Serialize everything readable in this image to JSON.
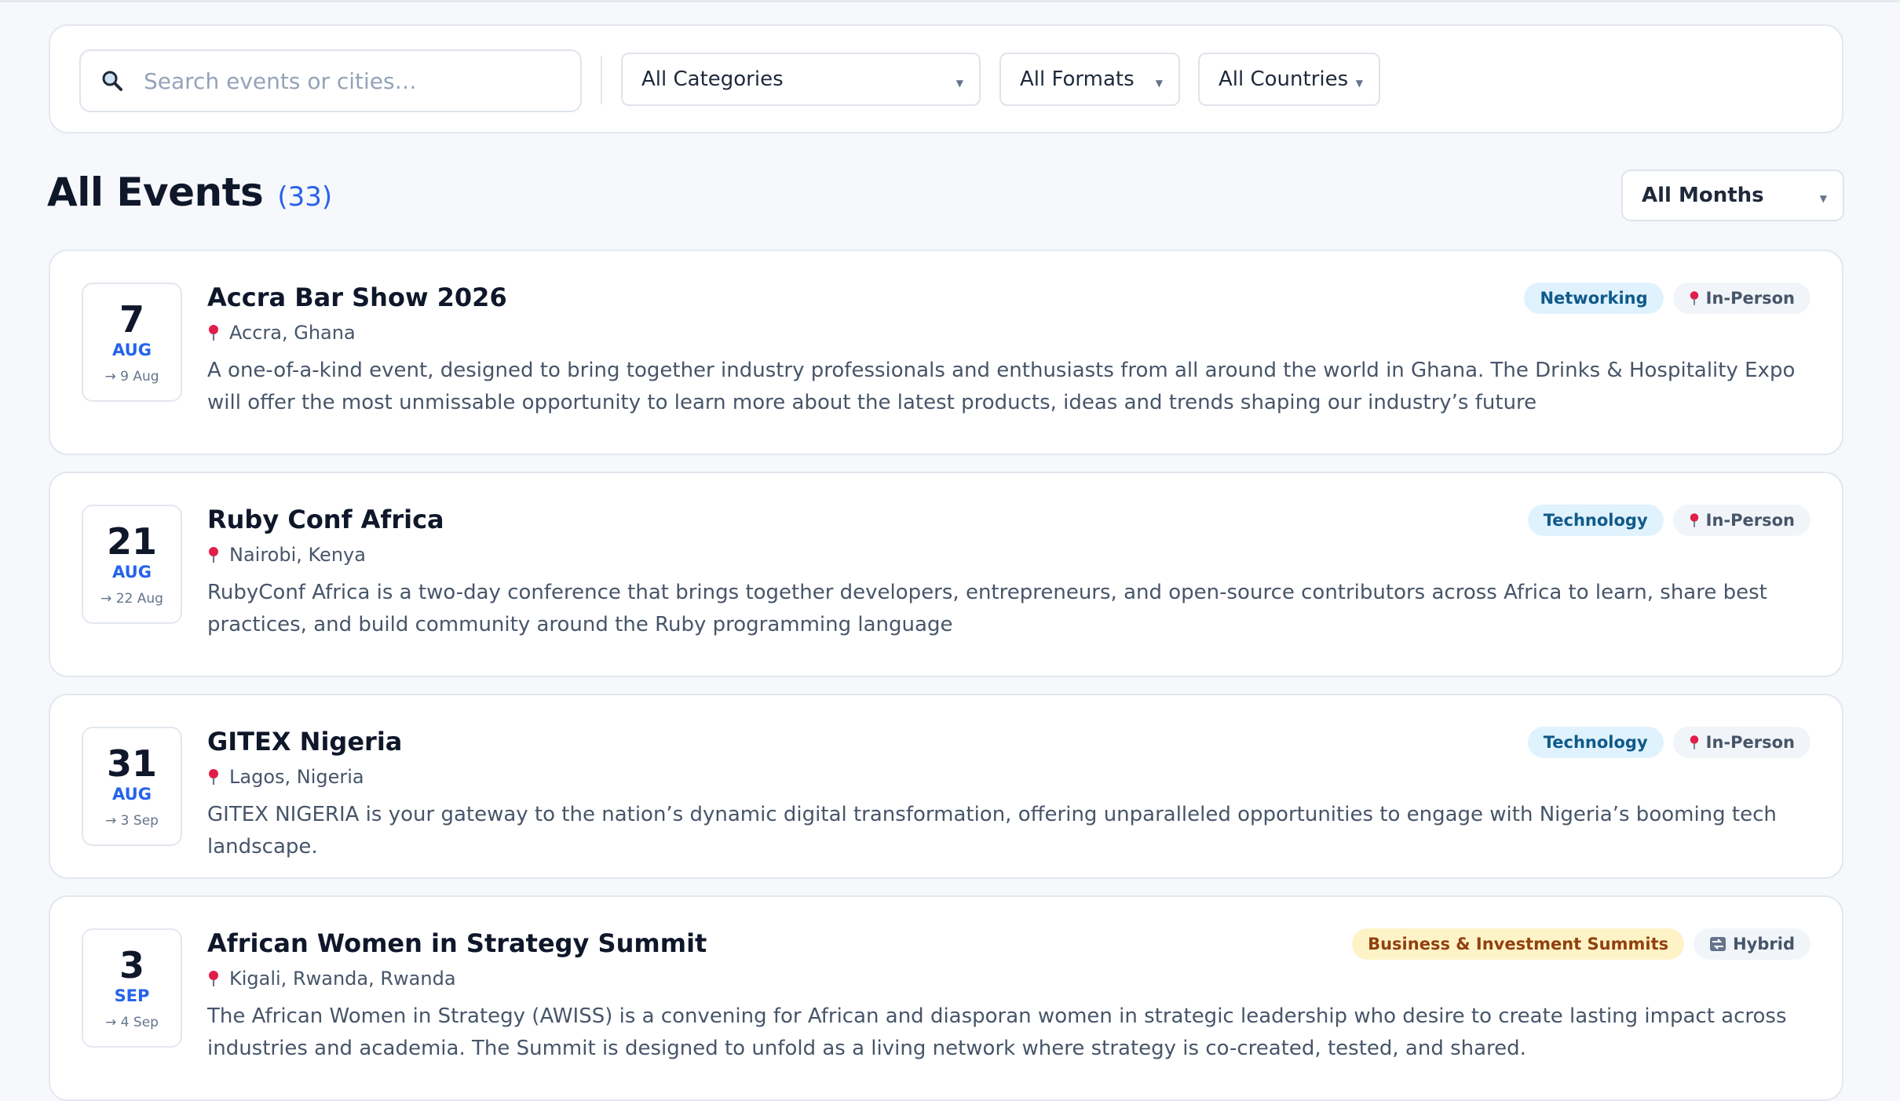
{
  "search": {
    "placeholder": "Search events or cities…",
    "icon": "search-icon"
  },
  "filters": {
    "category": "All Categories",
    "format": "All Formats",
    "country": "All Countries"
  },
  "heading": {
    "title": "All Events",
    "count": "(33)"
  },
  "month_filter": "All Months",
  "colors": {
    "accent": "#2563eb",
    "category_blue_bg": "#e0f2fe",
    "category_yellow_bg": "#fef3c7"
  },
  "events": [
    {
      "day": "7",
      "month": "AUG",
      "end": "→ 9 Aug",
      "title": "Accra Bar Show 2026",
      "location": "Accra, Ghana",
      "description": "A one-of-a-kind event, designed to bring together industry professionals and enthusiasts from all around the world in Ghana. The Drinks & Hospitality Expo will offer the most unmissable opportunity to learn more about the latest products, ideas and trends shaping our industry’s future",
      "category": "Networking",
      "format": "In-Person",
      "format_icon": "pin-icon"
    },
    {
      "day": "21",
      "month": "AUG",
      "end": "→ 22 Aug",
      "title": "Ruby Conf Africa",
      "location": "Nairobi, Kenya",
      "description": "RubyConf Africa is a two-day conference that brings together developers, entrepreneurs, and open-source contributors across Africa to learn, share best practices, and build community around the Ruby programming language",
      "category": "Technology",
      "format": "In-Person",
      "format_icon": "pin-icon"
    },
    {
      "day": "31",
      "month": "AUG",
      "end": "→ 3 Sep",
      "title": "GITEX Nigeria",
      "location": "Lagos, Nigeria",
      "description": "GITEX NIGERIA is your gateway to the nation’s dynamic digital transformation, offering unparalleled opportunities to engage with Nigeria’s booming tech landscape.",
      "category": "Technology",
      "format": "In-Person",
      "format_icon": "pin-icon"
    },
    {
      "day": "3",
      "month": "SEP",
      "end": "→ 4 Sep",
      "title": "African Women in Strategy Summit",
      "location": "Kigali, Rwanda, Rwanda",
      "description": "The African Women in Strategy (AWISS) is a convening for African and diasporan women in strategic leadership who desire to create lasting impact across industries and academia.  The Summit is designed to unfold as a living network where strategy is co-created, tested, and shared.",
      "category": "Business & Investment Summits",
      "format": "Hybrid",
      "format_icon": "hybrid-icon"
    }
  ]
}
